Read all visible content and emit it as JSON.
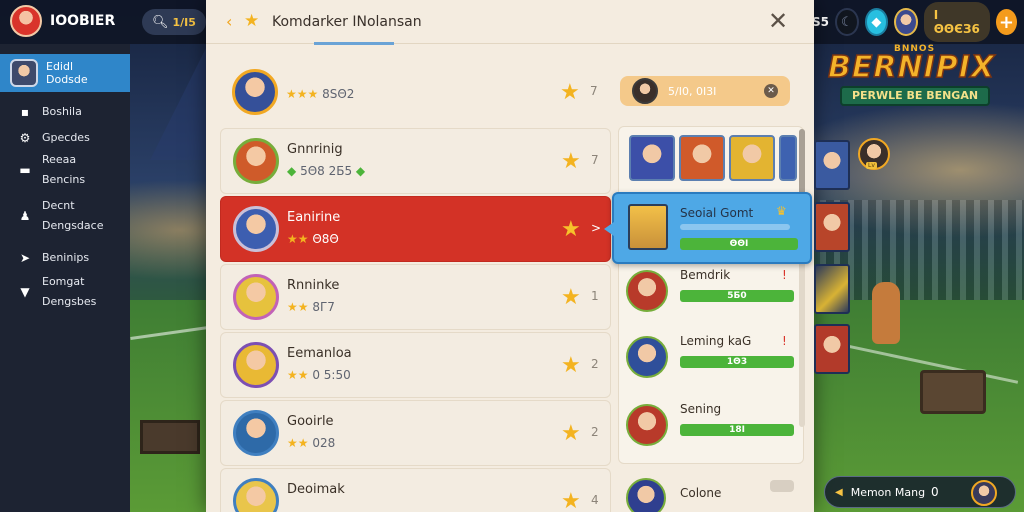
{
  "colors": {
    "accent_red": "#d33226",
    "accent_blue": "#4ea8e6",
    "gold": "#f3b320",
    "green": "#4cb43a"
  },
  "app": {
    "name": "IOOBIER",
    "logo_icon": "app-logo-icon"
  },
  "search": {
    "icon": "search-icon",
    "value": "1/I5"
  },
  "topright": {
    "value": "I ΘΘЄЗ6",
    "moon_icon": "moon-icon",
    "gem_icon": "gem-icon",
    "plus": "+"
  },
  "sidebar": {
    "active": {
      "line1": "Edidl",
      "line2": "Dodsde"
    },
    "items": [
      {
        "icon": "id-card-icon",
        "lines": [
          "Boshila"
        ]
      },
      {
        "icon": "gear-icon",
        "lines": [
          "Gpecdes"
        ]
      },
      {
        "icon": "film-icon",
        "lines": [
          "Reeaa",
          "Bencins"
        ]
      },
      {
        "icon": "people-icon",
        "lines": [
          "Decnt",
          "Dengsdace"
        ]
      },
      {
        "icon": "tag-icon",
        "lines": [
          "Beninips"
        ]
      },
      {
        "icon": "inbox-icon",
        "lines": [
          "Eomgat",
          "Dengsbes"
        ]
      }
    ]
  },
  "modal": {
    "title": "Komdarker INolansan",
    "close": "✕",
    "rows": [
      {
        "name": "",
        "meta": "8SΘ2",
        "num": "7"
      },
      {
        "name": "Gnnrinig",
        "meta": "5Θ8 2Б5",
        "num": "7"
      },
      {
        "name": "Eanirine",
        "meta": "Θ8Θ",
        "num": ">"
      },
      {
        "name": "Rnninke",
        "meta": "8Г7",
        "num": "1"
      },
      {
        "name": "Eemanloa",
        "meta": "0 5:50",
        "num": "2"
      },
      {
        "name": "Gooirle",
        "meta": "028",
        "num": "2"
      },
      {
        "name": "Deoimak",
        "meta": "",
        "num": "4"
      }
    ],
    "top_pill": {
      "text": "5/Ι0, 0Ι3Ι"
    },
    "selected": {
      "name": "Seoial Gomt",
      "value": "ΘΘΙ"
    },
    "contacts": [
      {
        "name": "Bemdrik",
        "value": "5Б0",
        "icon": "!"
      },
      {
        "name": "Leming kaG",
        "value": "1Θ3",
        "icon": "!"
      },
      {
        "name": "Sening",
        "value": "18Ι",
        "icon": ""
      }
    ],
    "last_contact": {
      "name": "Colone"
    }
  },
  "game_logo": {
    "top": "BNNOS",
    "main": "BERNIPIX",
    "sub": "PERWLE BE BENGAN"
  },
  "bottom_pill": {
    "text": "Memon Mang",
    "count": "0"
  }
}
